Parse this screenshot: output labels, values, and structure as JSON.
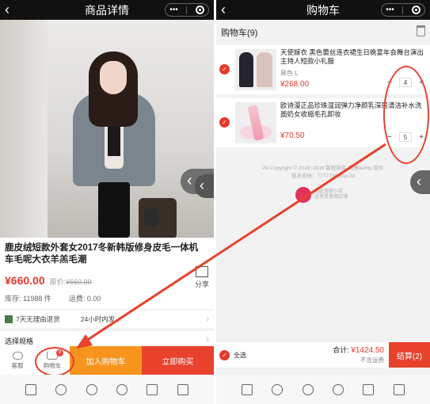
{
  "left": {
    "title": "商品详情",
    "back": "‹",
    "capsule_more": "•••",
    "product_title": "鹿皮绒短款外套女2017冬新韩版修身皮毛一体机车毛呢大衣羊羔毛潮",
    "price": "¥660.00",
    "original_label": "原价:",
    "original_price": "¥660.00",
    "share_label": "分享",
    "stock": "库存: 11988 件",
    "shipping": "运费: 0.00",
    "guarantee_1": "7天无理由退货",
    "guarantee_2": "24小时内发…",
    "spec_label": "选择规格",
    "service_label": "客服",
    "cart_label": "购物车",
    "cart_badge": "9",
    "add_cart": "加入购物车",
    "buy_now": "立即购买"
  },
  "right": {
    "title": "购物车",
    "back": "‹",
    "capsule_more": "•••",
    "cart_heading": "购物车(9)",
    "items": [
      {
        "name": "天使嫁衣 黑色蕾丝连衣裙生日晚宴年会舞台演出主持人短款小礼服",
        "sku": "黑色 L",
        "price": "¥268.00",
        "qty": "4"
      },
      {
        "name": "欧诗漫正品珍珠湿润弹力净颜乳深层清洁补水洗面奶女收缩毛孔卸妆",
        "sku": "",
        "price": "¥70.50",
        "qty": "5"
      }
    ],
    "copyright_1": "All Copyright © 2016~2018 版权所有-四博&amp;软件",
    "copyright_2": "技术支持：777773&amp;33",
    "brand_text_1": "如此美丽小店",
    "brand_text_2": "这里是美丽店铺",
    "select_all": "全选",
    "total_label": "合计:",
    "total_value": "¥1424.50",
    "no_shipping": "不含运费",
    "checkout": "结算(2)"
  },
  "accent": "#e8412c"
}
